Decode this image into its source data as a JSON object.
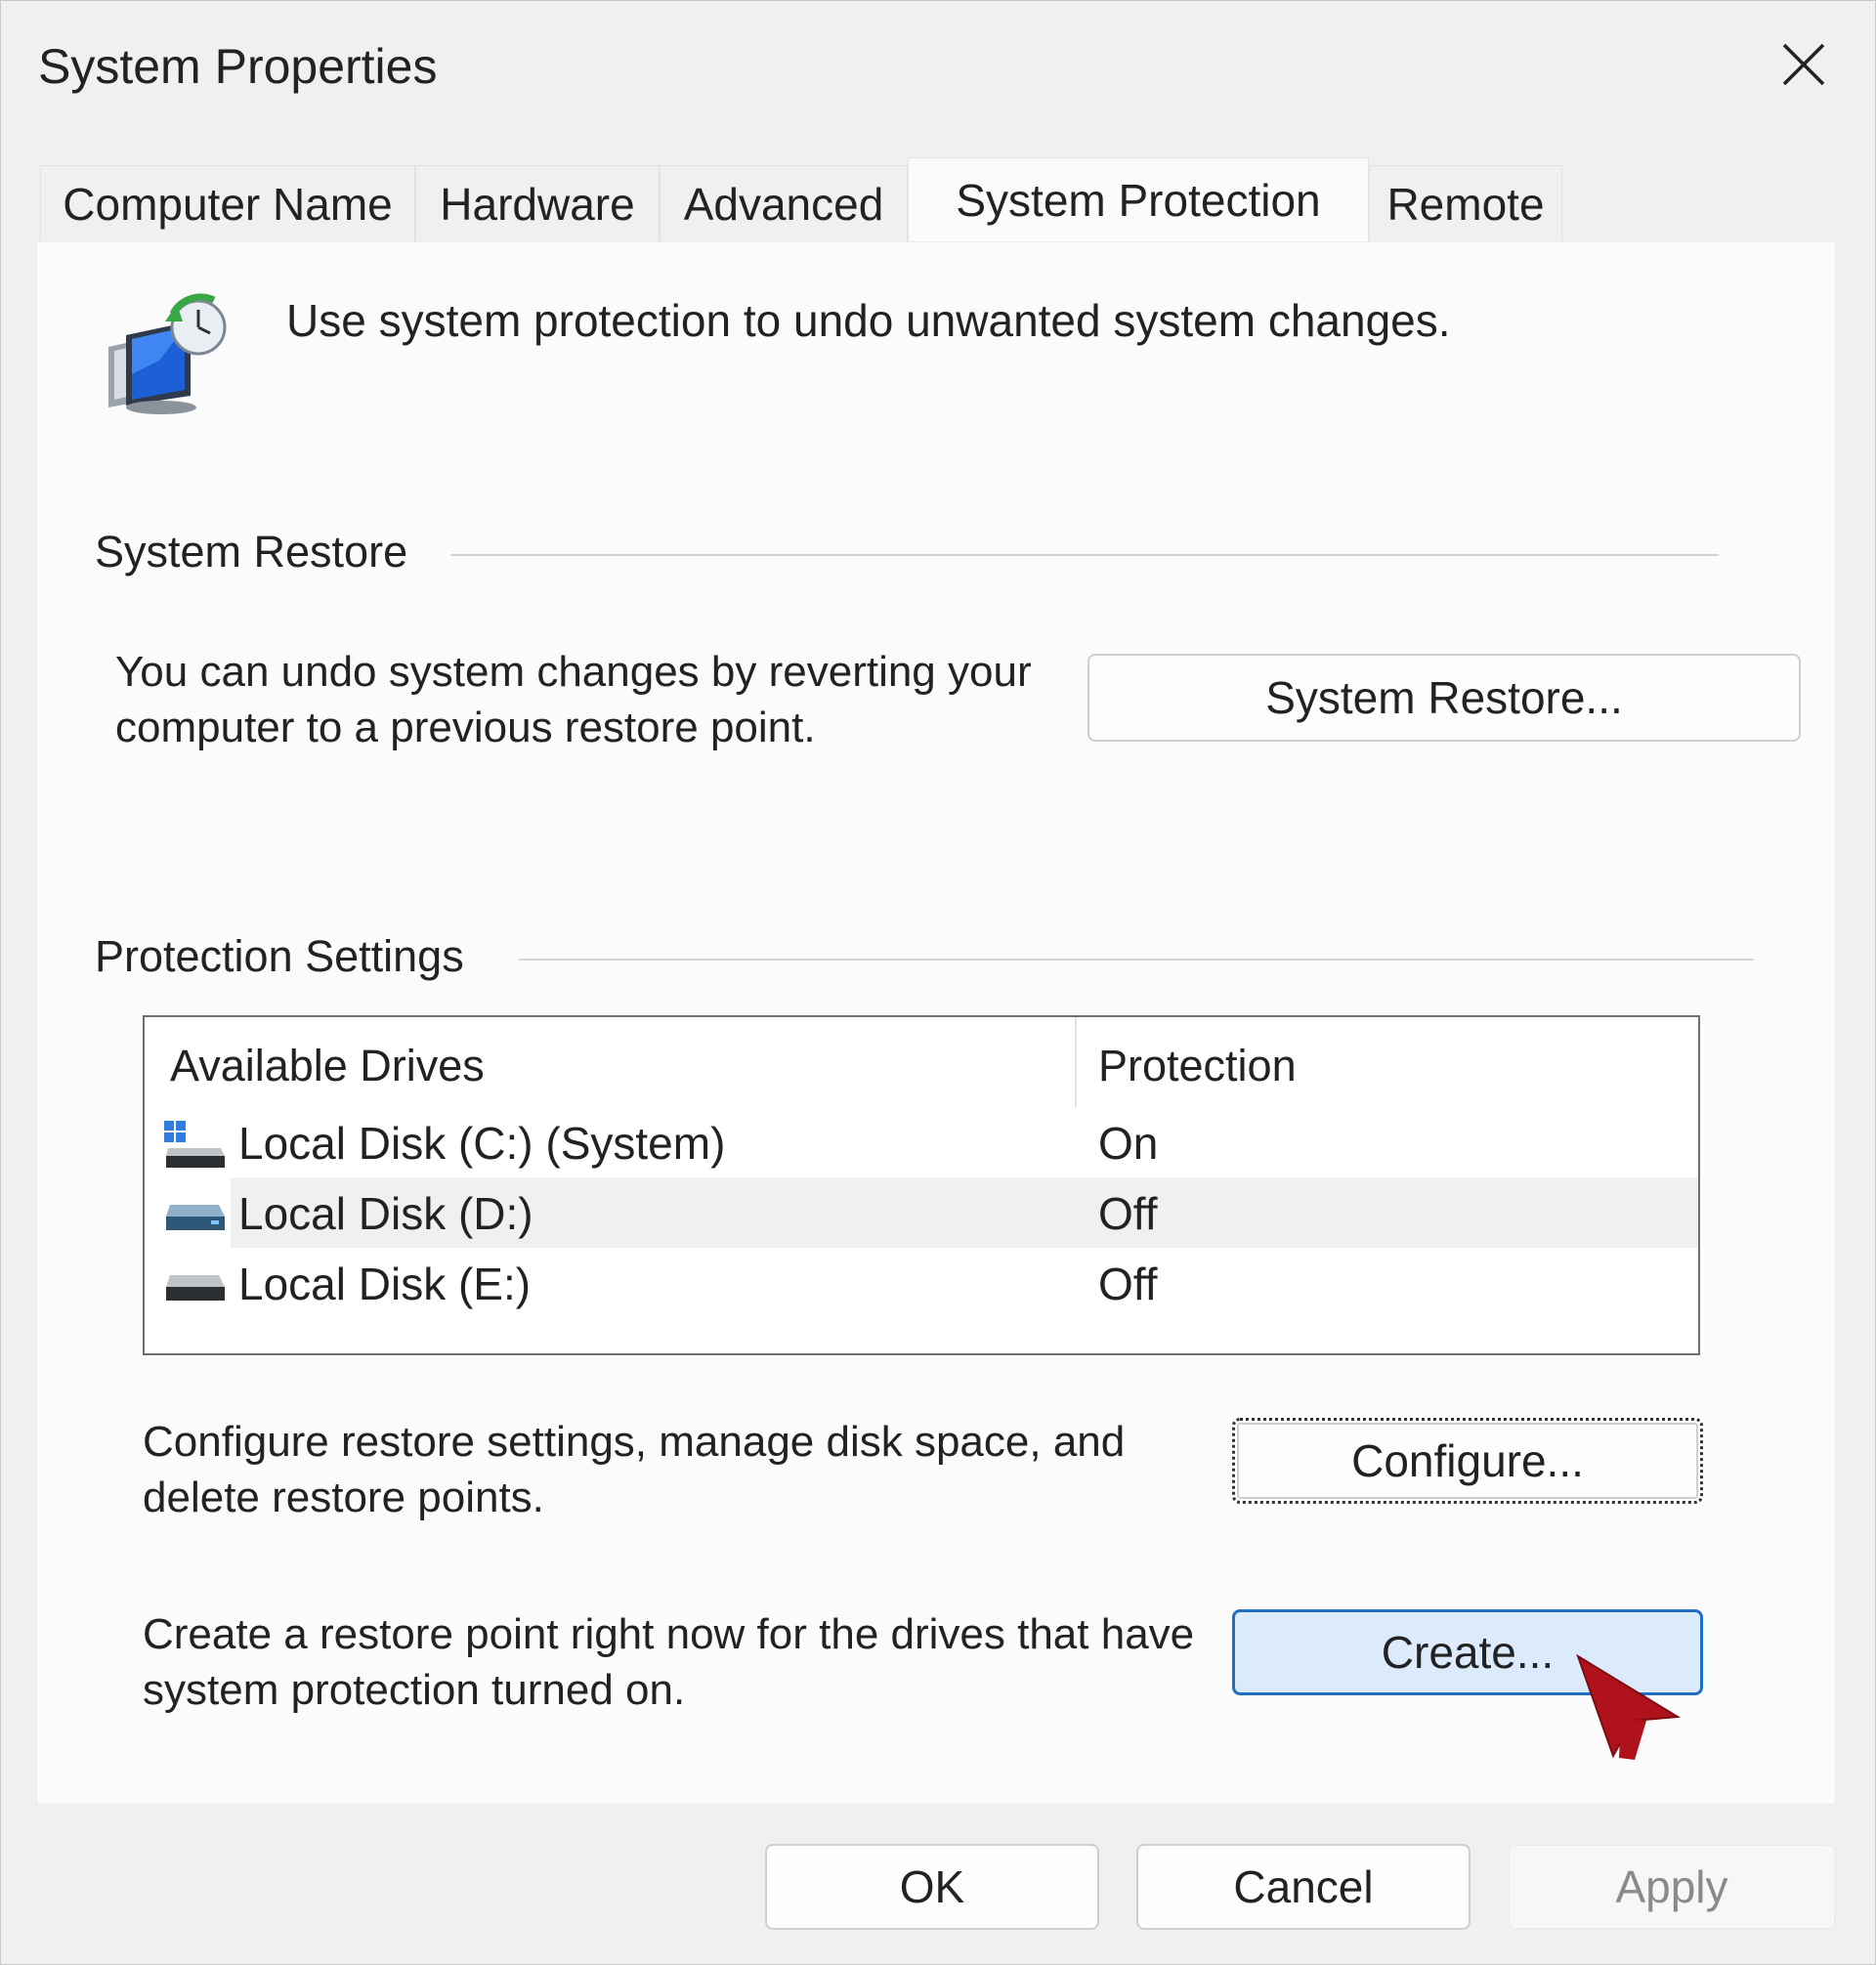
{
  "window": {
    "title": "System Properties"
  },
  "tabs": [
    {
      "label": "Computer Name",
      "active": false
    },
    {
      "label": "Hardware",
      "active": false
    },
    {
      "label": "Advanced",
      "active": false
    },
    {
      "label": "System Protection",
      "active": true
    },
    {
      "label": "Remote",
      "active": false
    }
  ],
  "intro": {
    "text": "Use system protection to undo unwanted system changes.",
    "icon": "system-protection-icon"
  },
  "system_restore": {
    "title": "System Restore",
    "description": "You can undo system changes by reverting your computer to a previous restore point.",
    "button_label": "System Restore..."
  },
  "protection_settings": {
    "title": "Protection Settings",
    "columns": [
      "Available Drives",
      "Protection"
    ],
    "drives": [
      {
        "name": "Local Disk (C:) (System)",
        "protection": "On",
        "icon": "system-drive-icon"
      },
      {
        "name": "Local Disk (D:)",
        "protection": "Off",
        "icon": "drive-icon",
        "selected": true
      },
      {
        "name": "Local Disk (E:)",
        "protection": "Off",
        "icon": "drive-icon"
      }
    ],
    "configure_text": "Configure restore settings, manage disk space, and delete restore points.",
    "configure_label": "Configure...",
    "create_text": "Create a restore point right now for the drives that have system protection turned on.",
    "create_label": "Create..."
  },
  "footer": {
    "ok_label": "OK",
    "cancel_label": "Cancel",
    "apply_label": "Apply"
  },
  "colors": {
    "accent": "#1f6fc5",
    "hover_fill": "#dcebfb",
    "cursor": "#b0121b"
  }
}
